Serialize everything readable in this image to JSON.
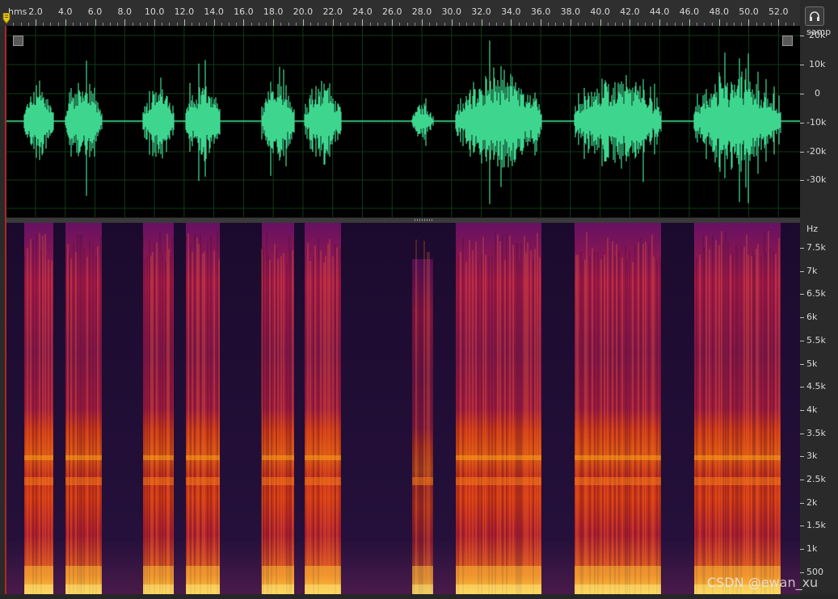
{
  "timeline": {
    "unit": "hms",
    "labels": [
      "2.0",
      "4.0",
      "6.0",
      "8.0",
      "10.0",
      "12.0",
      "14.0",
      "16.0",
      "18.0",
      "20.0",
      "22.0",
      "24.0",
      "26.0",
      "28.0",
      "30.0",
      "32.0",
      "34.0",
      "36.0",
      "38.0",
      "40.0",
      "42.0",
      "44.0",
      "46.0",
      "48.0",
      "50.0",
      "52.0"
    ]
  },
  "waveform": {
    "unit": "samp",
    "labels": [
      "20k",
      "10k",
      "0",
      "-10k",
      "-20k",
      "-30k"
    ],
    "color": "#3ed68f"
  },
  "spectrogram": {
    "unit": "Hz",
    "labels": [
      "7.5k",
      "7k",
      "6.5k",
      "6k",
      "5.5k",
      "5k",
      "4.5k",
      "4k",
      "3.5k",
      "3k",
      "2.5k",
      "2k",
      "1.5k",
      "1k",
      "500"
    ]
  },
  "controls": {
    "headphone_icon": "headphone-icon"
  },
  "watermark": "CSDN @ewan_xu"
}
